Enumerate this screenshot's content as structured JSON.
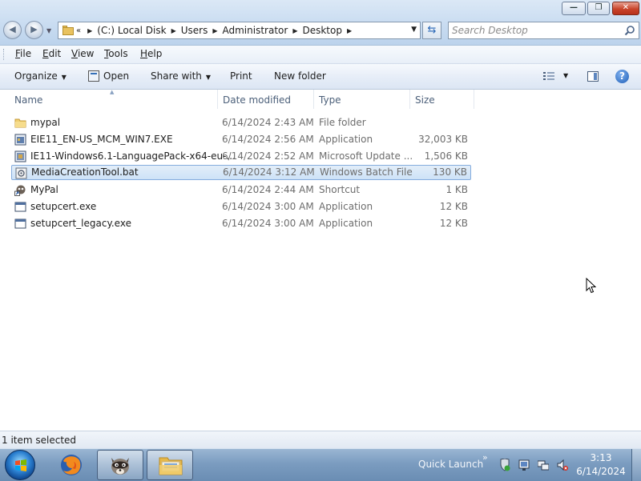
{
  "window": {
    "minimize_glyph": "—",
    "maximize_glyph": "❐",
    "close_glyph": "✕"
  },
  "address": {
    "overflow": "«",
    "crumbs": [
      "(C:) Local Disk",
      "Users",
      "Administrator",
      "Desktop"
    ]
  },
  "search": {
    "placeholder": "Search Desktop"
  },
  "menubar": {
    "items": [
      {
        "label": "File",
        "accel": "F"
      },
      {
        "label": "Edit",
        "accel": "E"
      },
      {
        "label": "View",
        "accel": "V"
      },
      {
        "label": "Tools",
        "accel": "T"
      },
      {
        "label": "Help",
        "accel": "H"
      }
    ]
  },
  "commandbar": {
    "organize": "Organize",
    "open": "Open",
    "share_with": "Share with",
    "print": "Print",
    "new_folder": "New folder"
  },
  "columns": {
    "name": "Name",
    "date_modified": "Date modified",
    "type": "Type",
    "size": "Size"
  },
  "files": [
    {
      "name": "mypal",
      "date": "6/14/2024 2:43 AM",
      "type": "File folder",
      "size": "",
      "icon": "folder-icon",
      "selected": false
    },
    {
      "name": "EIE11_EN-US_MCM_WIN7.EXE",
      "date": "6/14/2024 2:56 AM",
      "type": "Application",
      "size": "32,003 KB",
      "icon": "exe-icon",
      "selected": false
    },
    {
      "name": "IE11-Windows6.1-LanguagePack-x64-eu-...",
      "date": "6/14/2024 2:52 AM",
      "type": "Microsoft Update ...",
      "size": "1,506 KB",
      "icon": "msu-icon",
      "selected": false
    },
    {
      "name": "MediaCreationTool.bat",
      "date": "6/14/2024 3:12 AM",
      "type": "Windows Batch File",
      "size": "130 KB",
      "icon": "batch-file-icon",
      "selected": true
    },
    {
      "name": "MyPal",
      "date": "6/14/2024 2:44 AM",
      "type": "Shortcut",
      "size": "1 KB",
      "icon": "shortcut-icon",
      "selected": false
    },
    {
      "name": "setupcert.exe",
      "date": "6/14/2024 3:00 AM",
      "type": "Application",
      "size": "12 KB",
      "icon": "application-icon",
      "selected": false
    },
    {
      "name": "setupcert_legacy.exe",
      "date": "6/14/2024 3:00 AM",
      "type": "Application",
      "size": "12 KB",
      "icon": "application-icon",
      "selected": false
    }
  ],
  "status": {
    "text": "1 item selected"
  },
  "taskbar": {
    "quick_launch": "Quick Launch",
    "quick_launch_chevron": "»",
    "time": "3:13",
    "date": "6/14/2024",
    "pinned": [
      "firefox-icon",
      "mypal-raccoon-icon",
      "windows-explorer-icon"
    ],
    "tray": [
      "action-center-icon",
      "display-icon",
      "network-icon",
      "volume-muted-icon"
    ]
  },
  "colors": {
    "selection": "#cde2f7",
    "selection_border": "#84acdd",
    "taskbar": "#7b9cc0",
    "header_text": "#4c607a",
    "detail_text": "#6d6d6d"
  }
}
